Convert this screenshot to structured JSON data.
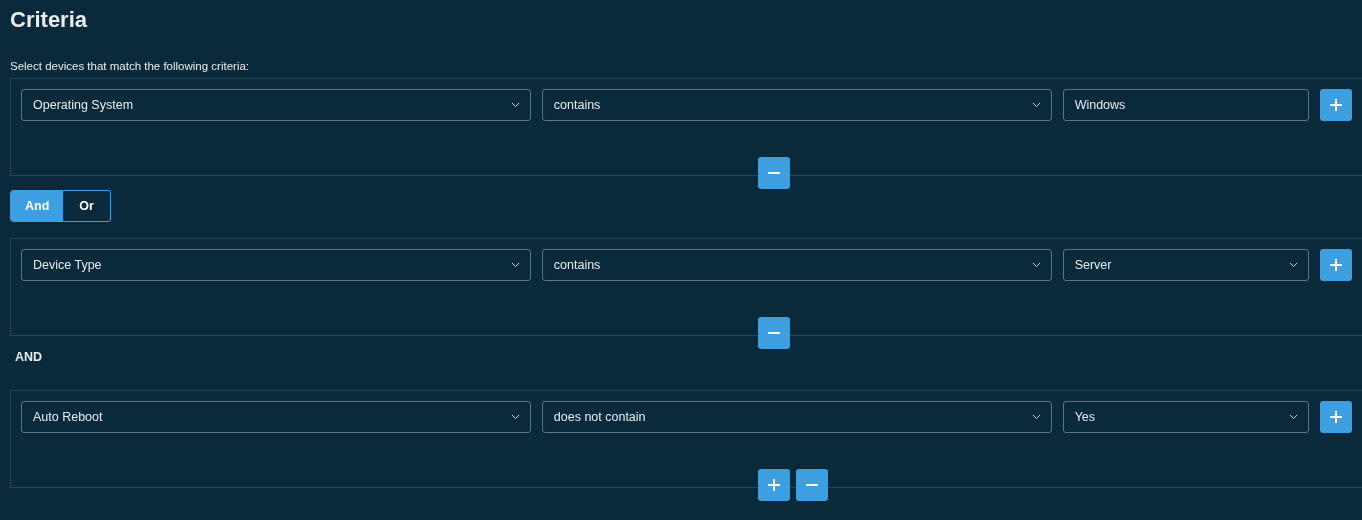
{
  "title": "Criteria",
  "intro": "Select devices that match the following criteria:",
  "blocks": [
    {
      "kind": "group",
      "conditions": [
        {
          "field": "Operating System",
          "operator": "contains",
          "value": {
            "kind": "text",
            "text": "Windows"
          }
        }
      ],
      "footer_buttons": [
        {
          "kind": "remove"
        }
      ]
    },
    {
      "kind": "toggle",
      "options": [
        {
          "label": "And",
          "selected": true
        },
        {
          "label": "Or",
          "selected": false
        }
      ]
    },
    {
      "kind": "group",
      "conditions": [
        {
          "field": "Device Type",
          "operator": "contains",
          "value": {
            "kind": "select",
            "text": "Server"
          }
        }
      ],
      "footer_buttons": [
        {
          "kind": "remove"
        }
      ]
    },
    {
      "kind": "label",
      "text": "AND"
    },
    {
      "kind": "group",
      "conditions": [
        {
          "field": "Auto Reboot",
          "operator": "does not contain",
          "value": {
            "kind": "select",
            "text": "Yes"
          }
        }
      ],
      "footer_buttons": [
        {
          "kind": "add"
        },
        {
          "kind": "remove"
        }
      ]
    }
  ]
}
